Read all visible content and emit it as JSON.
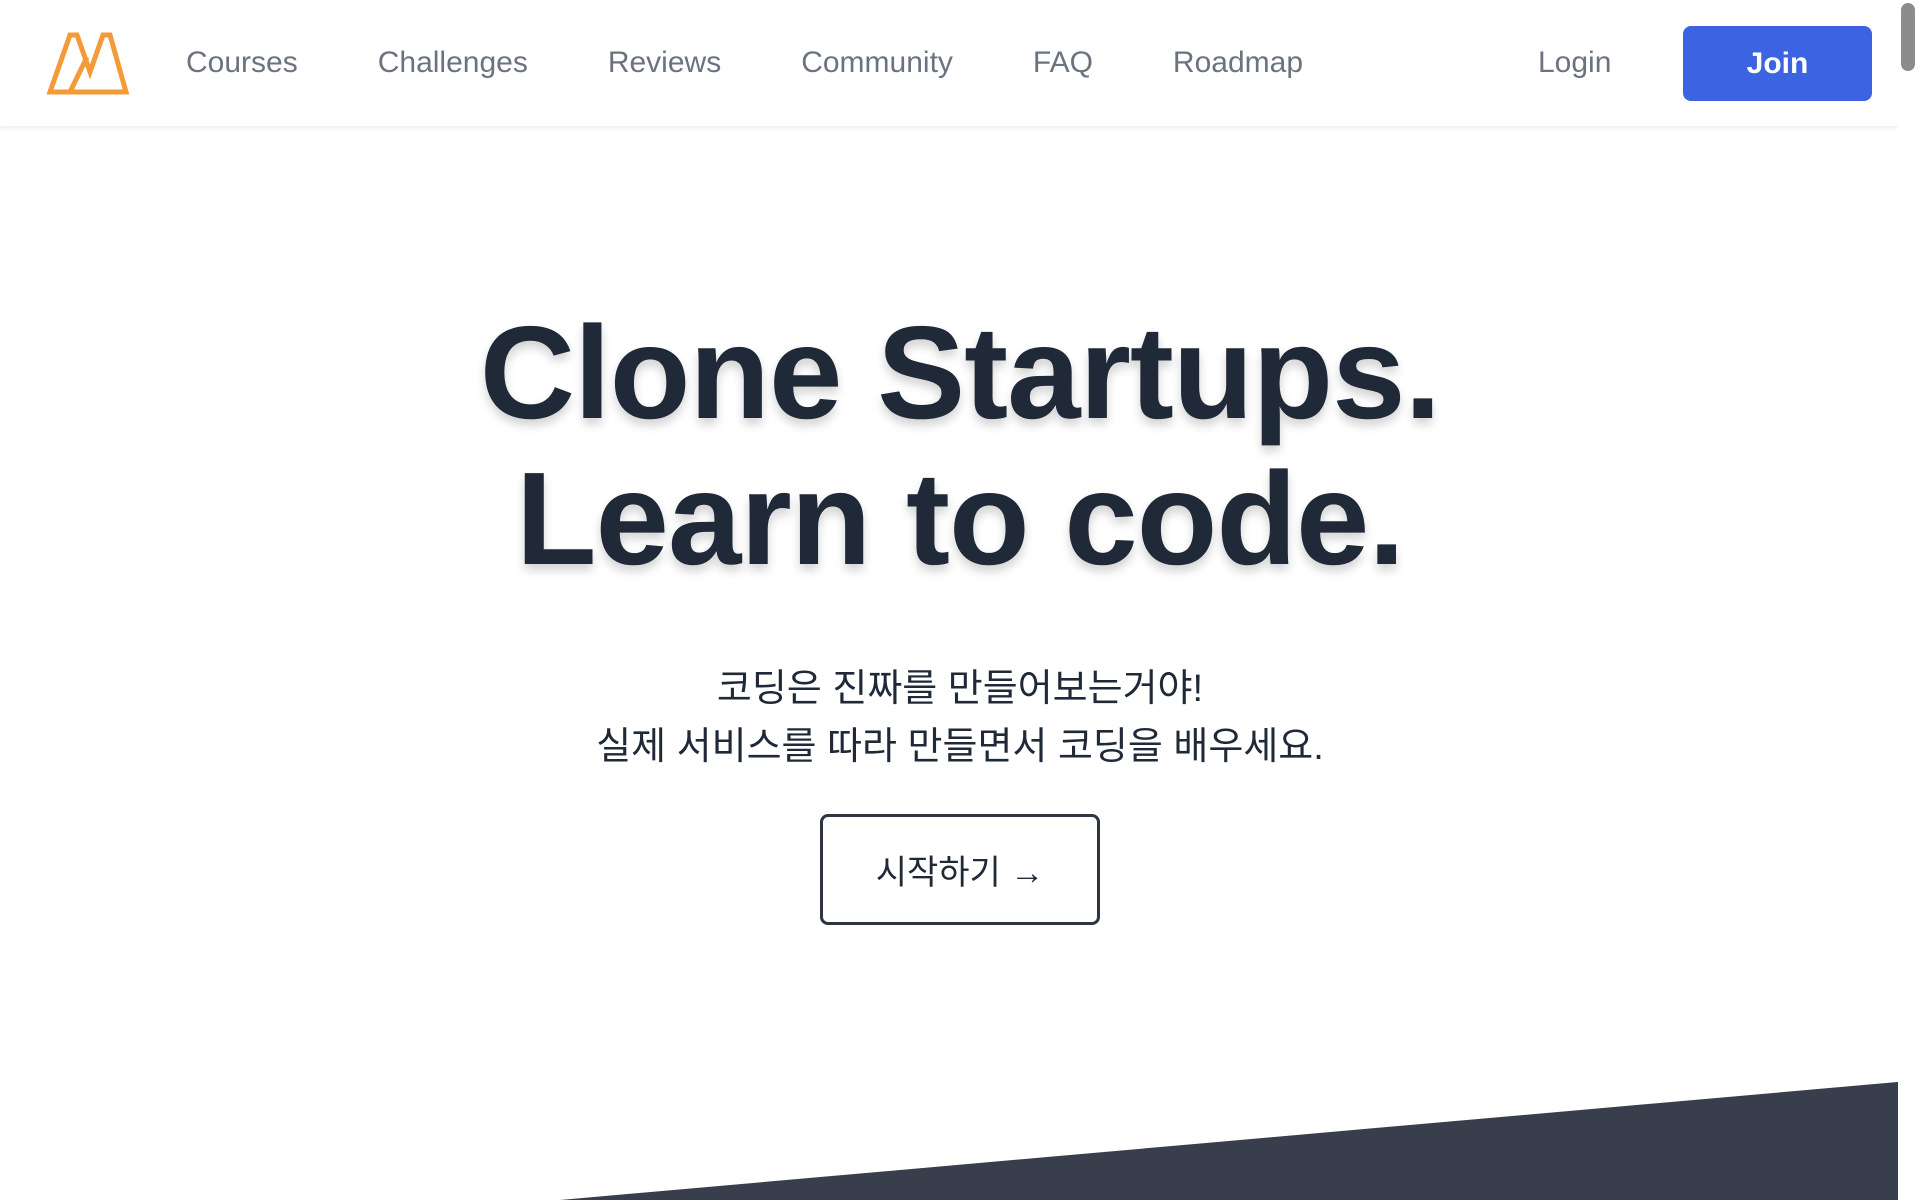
{
  "header": {
    "nav": [
      "Courses",
      "Challenges",
      "Reviews",
      "Community",
      "FAQ",
      "Roadmap"
    ],
    "login_label": "Login",
    "join_label": "Join"
  },
  "hero": {
    "title_line1": "Clone Startups.",
    "title_line2": "Learn to code.",
    "subtitle_line1": "코딩은 진짜를 만들어보는거야!",
    "subtitle_line2": "실제 서비스를 따라 만들면서 코딩을 배우세요.",
    "cta_label": "시작하기 →"
  },
  "colors": {
    "logo": "#f29b38",
    "primary": "#3b63e2",
    "dark_band": "#383e4c",
    "text_dark": "#1f2937",
    "nav_text": "#6b7280"
  },
  "icons": {
    "logo": "nomad-logo-icon"
  }
}
